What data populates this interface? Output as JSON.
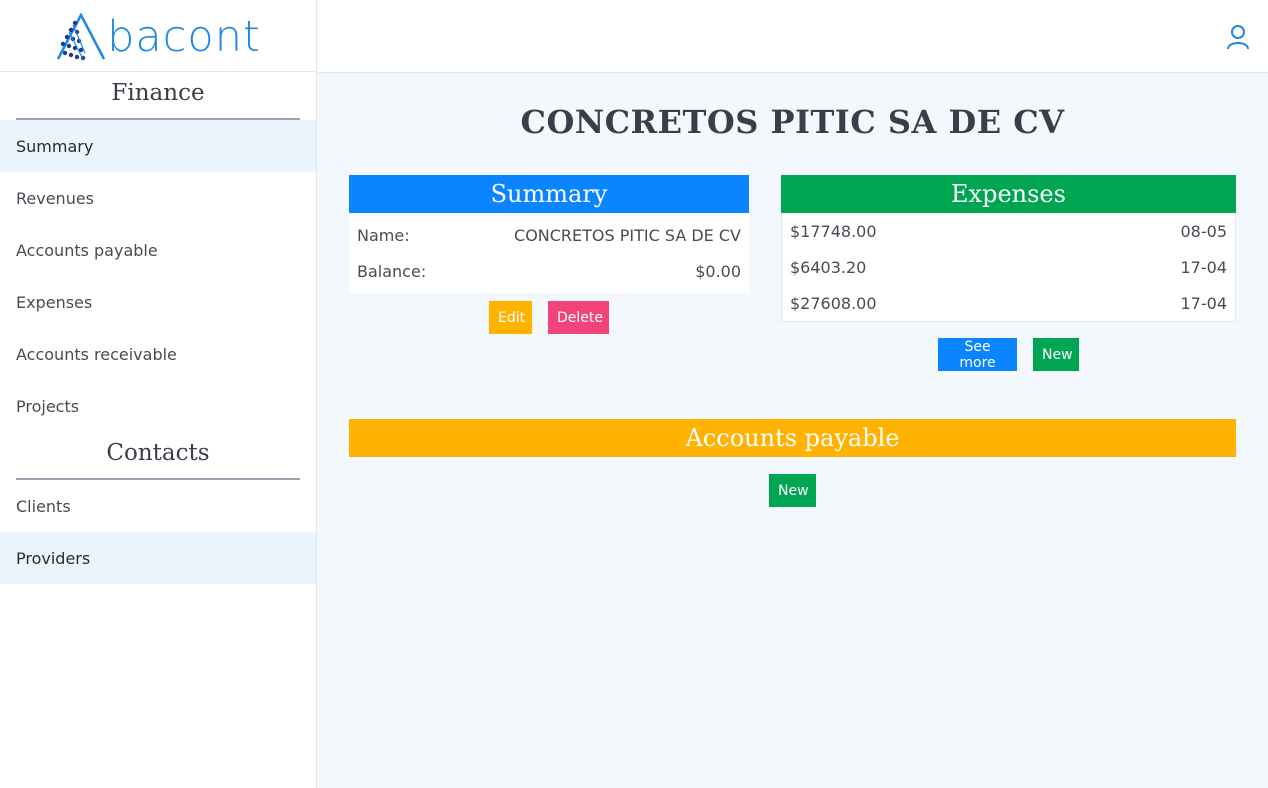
{
  "brand": {
    "name": "bacont",
    "color": "#1e88e5"
  },
  "sidebar": {
    "finance_title": "Finance",
    "finance_items": [
      {
        "label": "Summary",
        "active": true
      },
      {
        "label": "Revenues"
      },
      {
        "label": "Accounts payable"
      },
      {
        "label": "Expenses"
      },
      {
        "label": "Accounts receivable"
      },
      {
        "label": "Projects"
      }
    ],
    "contacts_title": "Contacts",
    "contacts_items": [
      {
        "label": "Clients"
      },
      {
        "label": "Providers",
        "active": true
      }
    ]
  },
  "header": {
    "user_icon": "user-icon"
  },
  "main": {
    "title": "CONCRETOS PITIC SA DE CV",
    "summary": {
      "header": "Summary",
      "rows": [
        {
          "label": "Name:",
          "value": "CONCRETOS PITIC SA DE CV"
        },
        {
          "label": "Balance:",
          "value": "$0.00"
        }
      ],
      "edit_label": "Edit",
      "delete_label": "Delete"
    },
    "expenses": {
      "header": "Expenses",
      "rows": [
        {
          "amount": "$17748.00",
          "date": "08-05"
        },
        {
          "amount": "$6403.20",
          "date": "17-04"
        },
        {
          "amount": "$27608.00",
          "date": "17-04"
        }
      ],
      "see_more_label": "See more",
      "new_label": "New"
    },
    "accounts_payable": {
      "header": "Accounts payable",
      "new_label": "New"
    }
  },
  "colors": {
    "summary": "#0a84ff",
    "expenses": "#00a552",
    "accounts_payable": "#ffb300",
    "delete": "#f0447a"
  }
}
